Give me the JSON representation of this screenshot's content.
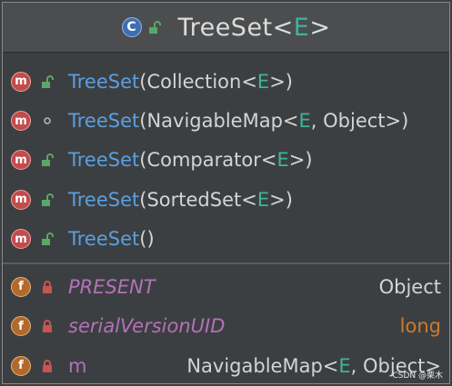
{
  "header": {
    "class_icon_letter": "C",
    "title_name": "TreeSet",
    "title_lt": "<",
    "title_type": "E",
    "title_gt": ">"
  },
  "methods": [
    {
      "name": "TreeSet",
      "open": "(",
      "pre": "Collection<",
      "type": "E",
      "post": ">)",
      "visibility": "public"
    },
    {
      "name": "TreeSet",
      "open": "(",
      "pre": "NavigableMap<",
      "type": "E",
      "post": ", Object>)",
      "visibility": "package"
    },
    {
      "name": "TreeSet",
      "open": "(",
      "pre": "Comparator<",
      "type": "E",
      "post": ">)",
      "visibility": "public"
    },
    {
      "name": "TreeSet",
      "open": "(",
      "pre": "SortedSet<",
      "type": "E",
      "post": ">)",
      "visibility": "public"
    },
    {
      "name": "TreeSet",
      "open": "()",
      "pre": "",
      "type": "",
      "post": "",
      "visibility": "public"
    }
  ],
  "method_badge_letter": "m",
  "field_badge_letter": "f",
  "fields": [
    {
      "name": "PRESENT",
      "type_pre": "Object",
      "type": "",
      "type_post": ""
    },
    {
      "name": "serialVersionUID",
      "type_pre": "long",
      "type": "",
      "type_post": ""
    },
    {
      "name": "m",
      "type_pre": "NavigableMap<",
      "type": "E",
      "type_post": ", Object>"
    }
  ],
  "watermark": "CSDN @栗木",
  "colors": {
    "method_name": "#5a9fe0",
    "type_param": "#3fb39b",
    "field_name": "#b272b8",
    "primitive": "#cc7832",
    "lock_open": "#59a869",
    "lock_closed": "#c75450"
  }
}
